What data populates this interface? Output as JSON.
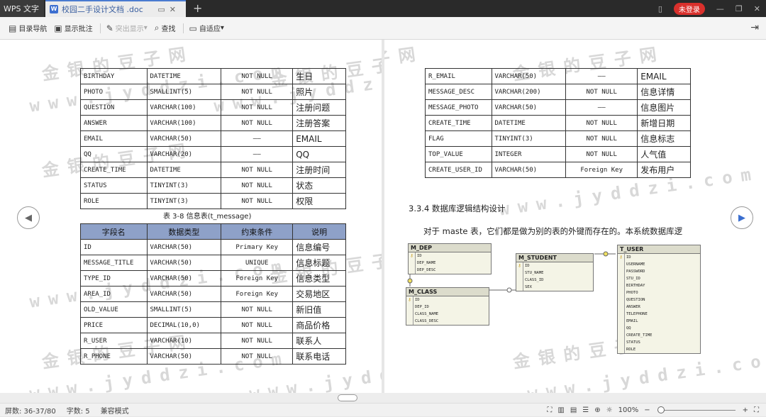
{
  "titlebar": {
    "app_tab": "WPS 文字",
    "doc_tab": "校园二手设计文档 .doc",
    "login": "未登录"
  },
  "toolbar": {
    "items": [
      "目录导航",
      "显示批注",
      "突出显示",
      "查找",
      "自适应"
    ]
  },
  "left_table_top": [
    [
      "BIRTHDAY",
      "DATETIME",
      "NOT NULL",
      "生日"
    ],
    [
      "PHOTO",
      "SMALLINT(5)",
      "NOT NULL",
      "照片"
    ],
    [
      "QUESTION",
      "VARCHAR(100)",
      "NOT NULL",
      "注册问题"
    ],
    [
      "ANSWER",
      "VARCHAR(100)",
      "NOT NULL",
      "注册答案"
    ],
    [
      "EMAIL",
      "VARCHAR(50)",
      "——",
      "EMAIL"
    ],
    [
      "QQ",
      "VARCHAR(20)",
      "——",
      "QQ"
    ],
    [
      "CREATE_TIME",
      "DATETIME",
      "NOT NULL",
      "注册时间"
    ],
    [
      "STATUS",
      "TINYINT(3)",
      "NOT NULL",
      "状态"
    ],
    [
      "ROLE",
      "TINYINT(3)",
      "NOT NULL",
      "权限"
    ]
  ],
  "caption": "表 3-8 信息表(t_message)",
  "left_table_bottom": {
    "headers": [
      "字段名",
      "数据类型",
      "约束条件",
      "说明"
    ],
    "rows": [
      [
        "ID",
        "VARCHAR(50)",
        "Primary Key",
        "信息编号"
      ],
      [
        "MESSAGE_TITLE",
        "VARCHAR(50)",
        "UNIQUE",
        "信息标题"
      ],
      [
        "TYPE_ID",
        "VARCHAR(50)",
        "Foreign Key",
        "信息类型"
      ],
      [
        "AREA_ID",
        "VARCHAR(50)",
        "Foreign Key",
        "交易地区"
      ],
      [
        "OLD_VALUE",
        "SMALLINT(5)",
        "NOT NULL",
        "新旧值"
      ],
      [
        "PRICE",
        "DECIMAL(10,0)",
        "NOT NULL",
        "商品价格"
      ],
      [
        "R_USER",
        "VARCHAR(10)",
        "NOT NULL",
        "联系人"
      ],
      [
        "R_PHONE",
        "VARCHAR(50)",
        "NOT NULL",
        "联系电话"
      ]
    ]
  },
  "right_table": [
    [
      "R_EMAIL",
      "VARCHAR(50)",
      "——",
      "EMAIL"
    ],
    [
      "MESSAGE_DESC",
      "VARCHAR(200)",
      "NOT NULL",
      "信息详情"
    ],
    [
      "MESSAGE_PHOTO",
      "VARCHAR(50)",
      "——",
      "信息图片"
    ],
    [
      "CREATE_TIME",
      "DATETIME",
      "NOT NULL",
      "新增日期"
    ],
    [
      "FLAG",
      "TINYINT(3)",
      "NOT NULL",
      "信息标志"
    ],
    [
      "TOP_VALUE",
      "INTEGER",
      "NOT NULL",
      "人气值"
    ],
    [
      "CREATE_USER_ID",
      "VARCHAR(50)",
      "Foreign Key",
      "发布用户"
    ]
  ],
  "section_title": "3.3.4 数据库逻辑结构设计",
  "paragraph": "对于 maste 表，它们都是做为别的表的外键而存在的。本系统数据库逻",
  "diagram": {
    "entities": [
      {
        "name": "M_DEP",
        "fields": [
          "ID",
          "DEP_NAME",
          "DEP_DESC"
        ]
      },
      {
        "name": "M_CLASS",
        "fields": [
          "ID",
          "DEP_ID",
          "CLASS_NAME",
          "CLASS_DESC"
        ]
      },
      {
        "name": "M_STUDENT",
        "fields": [
          "ID",
          "STU_NAME",
          "CLASS_ID",
          "SEX"
        ]
      },
      {
        "name": "T_USER",
        "fields": [
          "ID",
          "USERNAME",
          "PASSWORD",
          "STU_ID",
          "BIRTHDAY",
          "PHOTO",
          "QUESTION",
          "ANSWER",
          "TELEPHONE",
          "EMAIL",
          "QQ",
          "CREATE_TIME",
          "STATUS",
          "ROLE"
        ]
      }
    ]
  },
  "watermark": {
    "cn": "金银的豆子网",
    "url": "www.jyddzi.com"
  },
  "statusbar": {
    "pages": "屏数: 36-37/80",
    "words": "字数: 5",
    "mode": "兼容模式",
    "zoom": "100%"
  }
}
